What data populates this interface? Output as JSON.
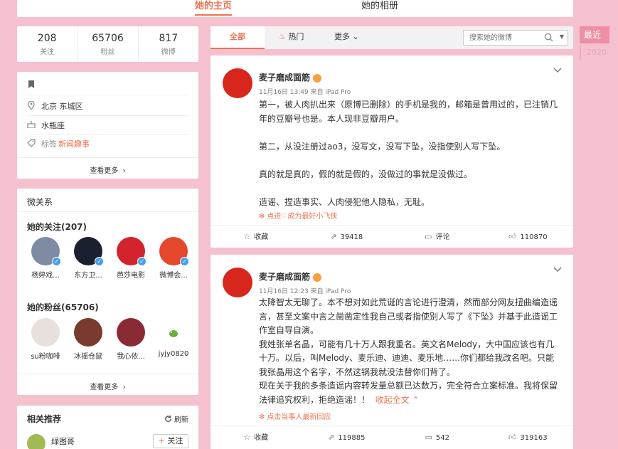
{
  "top_nav": {
    "tab_home": "她的主页",
    "tab_album": "她的相册"
  },
  "years": {
    "recent": "最近",
    "y2020": "2020"
  },
  "stats": [
    {
      "num": "208",
      "label": "关注"
    },
    {
      "num": "65706",
      "label": "粉丝"
    },
    {
      "num": "817",
      "label": "微博"
    }
  ],
  "profile": {
    "location": "北京 东城区",
    "constellation": "水瓶座",
    "tag_label": "标签",
    "tag_value": "新闻趣事",
    "more": "查看更多"
  },
  "relations": {
    "title": "微关系",
    "following_title": "她的关注(207)",
    "following": [
      {
        "name": "杨婷戏...",
        "color": "#7f8aa3"
      },
      {
        "name": "东方卫...",
        "color": "#1b2030"
      },
      {
        "name": "芭莎电影",
        "color": "#d3232c"
      },
      {
        "name": "微博会...",
        "color": "#e4472c"
      }
    ],
    "fans_title": "她的粉丝(65706)",
    "fans": [
      {
        "name": "su粉咖啡",
        "color": "#e8e0dc"
      },
      {
        "name": "冰摇仓鼠",
        "color": "#7b3a2e"
      },
      {
        "name": "我心依...",
        "color": "#8a2a34"
      },
      {
        "name": "jyjy0820",
        "color": "#ffffff"
      }
    ],
    "more": "查看更多"
  },
  "recommend": {
    "title": "相关推荐",
    "refresh": "刷新",
    "user_name": "绿图哥",
    "follow": "关注"
  },
  "filter": {
    "all": "全部",
    "hot": "热门",
    "more": "更多",
    "search_placeholder": "搜索她的微博"
  },
  "posts": [
    {
      "author": "麦子磨成面筋",
      "meta": "11月16日 13:49 来自 iPad Pro",
      "paragraphs": [
        "第一，被人肉扒出来（原博已删除）的手机是我的，邮箱是曾用过的，已注销几年的豆瓣号也是。本人现非豆瓣用户。",
        "第二，从没注册过ao3，没写文，没写下坠，没指使别人写下坠。",
        "真的就是真的，假的就是假的，没做过的事就是没做过。",
        "造谣、捏造事实、人肉侵犯他人隐私，无耻。"
      ],
      "note": "点进♡成为最好小飞侠",
      "actions": {
        "fav": "收藏",
        "repost": "39418",
        "comment": "评论",
        "like": "110870"
      }
    },
    {
      "author": "麦子磨成面筋",
      "meta": "11月16日 12:23 来自 iPad Pro",
      "paragraphs": [
        "太降智太无聊了。本不想对如此荒诞的言论进行澄清，然而部分网友扭曲编造谣言，甚至文案中言之凿凿定性我自己或者指使别人写了《下坠》并基于此造谣工作室自导自演。",
        "我姓张单名晶，可能有几十万人跟我重名。英文名Melody，大中国应该也有几十万。以后，叫Melody、麦乐迪、迪迪、麦乐地……你们都给我改名吧。只能我张晶用这个名字，不然这锅我就没法替你们背了。",
        "现在关于我的多条造谣内容转发量总额已达数万，完全符合立案标准。我将保留法律追究权利，拒绝造谣！！"
      ],
      "fold": "收起全文",
      "note": "点击当事人最新回应",
      "actions": {
        "fav": "收藏",
        "repost": "119885",
        "comment": "542",
        "like": "319163"
      }
    }
  ]
}
